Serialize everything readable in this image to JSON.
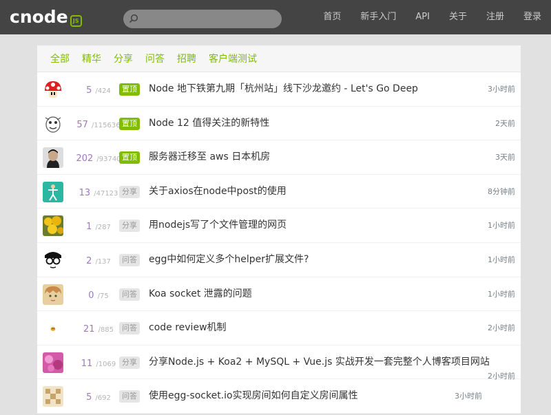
{
  "brand": {
    "logo_text": "cnode",
    "logo_badge": "JS"
  },
  "search": {
    "placeholder": ""
  },
  "nav": {
    "items": [
      {
        "label": "首页"
      },
      {
        "label": "新手入门"
      },
      {
        "label": "API"
      },
      {
        "label": "关于"
      },
      {
        "label": "注册"
      },
      {
        "label": "登录"
      }
    ]
  },
  "tabs": [
    {
      "label": "全部"
    },
    {
      "label": "精华"
    },
    {
      "label": "分享"
    },
    {
      "label": "问答"
    },
    {
      "label": "招聘"
    },
    {
      "label": "客户端测试"
    }
  ],
  "topics": [
    {
      "replies": "5",
      "visits": "/424",
      "tag": "置顶",
      "tag_type": "top",
      "title": "Node 地下铁第九期「杭州站」线下沙龙邀约 - Let's Go Deep",
      "time": "3小时前",
      "avatar": "mushroom"
    },
    {
      "replies": "57",
      "visits": "/115636",
      "tag": "置顶",
      "tag_type": "top",
      "title": "Node 12 值得关注的新特性",
      "time": "2天前",
      "avatar": "cartoon"
    },
    {
      "replies": "202",
      "visits": "/93740",
      "tag": "置顶",
      "tag_type": "top",
      "title": "服务器迁移至 aws 日本机房",
      "time": "3天前",
      "avatar": "portrait"
    },
    {
      "replies": "13",
      "visits": "/47123",
      "tag": "分享",
      "tag_type": "plain",
      "title": "关于axios在node中post的使用",
      "time": "8分钟前",
      "avatar": "teal"
    },
    {
      "replies": "1",
      "visits": "/287",
      "tag": "分享",
      "tag_type": "plain",
      "title": "用nodejs写了个文件管理的网页",
      "time": "1小时前",
      "avatar": "flowers"
    },
    {
      "replies": "2",
      "visits": "/137",
      "tag": "问答",
      "tag_type": "plain",
      "title": "egg中如何定义多个helper扩展文件?",
      "time": "1小时前",
      "avatar": "glasses"
    },
    {
      "replies": "0",
      "visits": "/75",
      "tag": "问答",
      "tag_type": "plain",
      "title": "Koa socket 泄露的问题",
      "time": "1小时前",
      "avatar": "anime"
    },
    {
      "replies": "21",
      "visits": "/885",
      "tag": "问答",
      "tag_type": "plain",
      "title": "code review机制",
      "time": "2小时前",
      "avatar": "tiny"
    },
    {
      "replies": "11",
      "visits": "/1069",
      "tag": "分享",
      "tag_type": "plain",
      "title": "分享Node.js + Koa2 + MySQL + Vue.js 实战开发一套完整个人博客项目网站",
      "time": "2小时前",
      "avatar": "pink"
    },
    {
      "replies": "5",
      "visits": "/692",
      "tag": "问答",
      "tag_type": "plain",
      "title": "使用egg-socket.io实现房间如何自定义房间属性",
      "time": "3小时前",
      "avatar": "pixel"
    }
  ],
  "colors": {
    "accent": "#80bd01",
    "navbar": "#444444",
    "reply": "#9e78c0"
  }
}
